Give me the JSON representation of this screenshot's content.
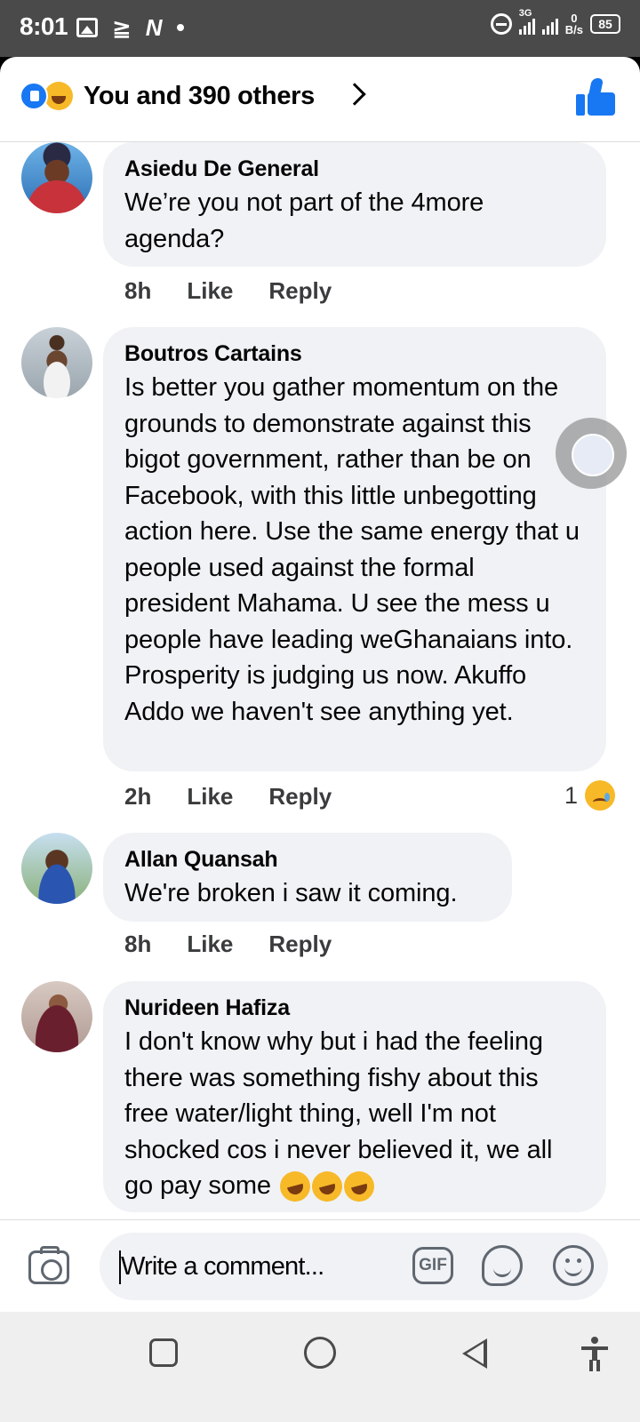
{
  "status_bar": {
    "time": "8:01",
    "left_icons": [
      "gallery-icon",
      "n-notification-icon",
      "app-notification-icon"
    ],
    "network_label": "3G",
    "net_speed_value": "0",
    "net_speed_unit": "B/s",
    "battery": "85"
  },
  "header": {
    "reactions": [
      "like-reaction-icon",
      "haha-reaction-icon"
    ],
    "reaction_text": "You and 390 others"
  },
  "comments": [
    {
      "author": "Asiedu De General",
      "text": "We’re you not part of the 4more agenda?",
      "time": "8h",
      "like_label": "Like",
      "reply_label": "Reply"
    },
    {
      "author": "Boutros Cartains",
      "text": "Is better you gather momentum on the grounds to demonstrate against this bigot government, rather than be on Facebook, with this little unbegotting action here. Use the same energy that u people used against the formal president Mahama. U see the mess u people have leading weGhanaians into. Prosperity is judging us now. Akuffo Addo we haven't see anything yet.",
      "time": "2h",
      "like_label": "Like",
      "reply_label": "Reply",
      "reaction_count": "1",
      "reaction_icon": "sad-reaction-icon"
    },
    {
      "author": "Allan Quansah",
      "text": "We're broken i saw it coming.",
      "time": "8h",
      "like_label": "Like",
      "reply_label": "Reply"
    },
    {
      "author": "Nurideen Hafiza",
      "text": "I don't know why but i had the feeling there was something fishy about this free water/light thing, well I'm not shocked cos i never believed it, we all go pay some",
      "text_emojis": [
        "laughing-tears-emoji",
        "laughing-tears-emoji",
        "laughing-tears-emoji"
      ]
    }
  ],
  "composer": {
    "placeholder": "Write a comment...",
    "gif_label": "GIF"
  },
  "nav_bar": {
    "buttons": [
      "recents-button",
      "home-button",
      "back-button",
      "accessibility-button"
    ]
  },
  "colors": {
    "accent": "#1877f2",
    "bubble": "#f0f2f5",
    "text": "#050505",
    "secondary_text": "#3a3b3c",
    "status_bar": "#4a4a4a"
  }
}
